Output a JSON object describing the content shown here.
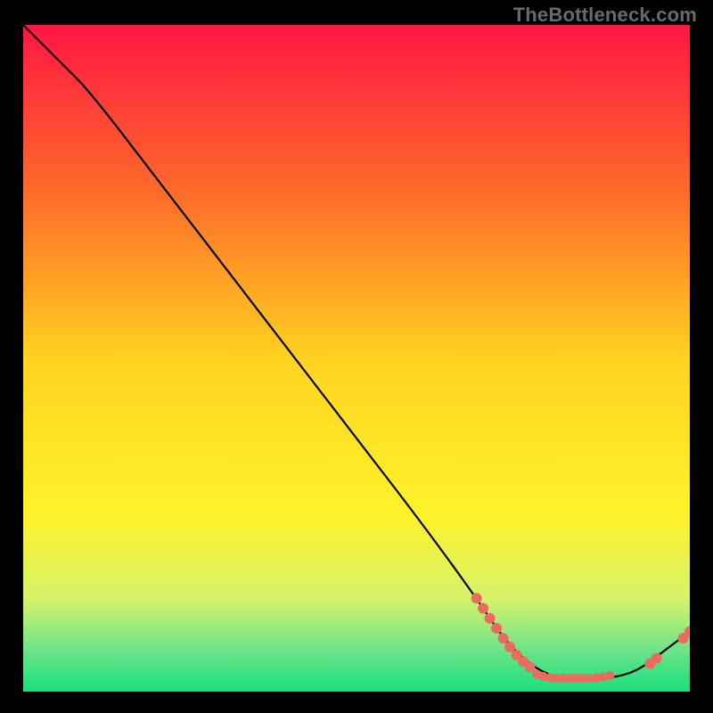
{
  "watermark": "TheBottleneck.com",
  "chart_data": {
    "type": "line",
    "title": "",
    "xlabel": "",
    "ylabel": "",
    "xlim": [
      0,
      100
    ],
    "ylim": [
      0,
      100
    ],
    "grid": false,
    "legend": false,
    "background_gradient": {
      "stops": [
        {
          "offset": 0.0,
          "color": "#ff1744"
        },
        {
          "offset": 0.25,
          "color": "#ff6a2a"
        },
        {
          "offset": 0.5,
          "color": "#ffd321"
        },
        {
          "offset": 0.73,
          "color": "#fff22a"
        },
        {
          "offset": 0.86,
          "color": "#d6f36a"
        },
        {
          "offset": 0.94,
          "color": "#6be38a"
        },
        {
          "offset": 1.0,
          "color": "#17e07a"
        }
      ]
    },
    "curve": {
      "name": "bottleneck-curve",
      "stroke": "#000000",
      "points": [
        {
          "x": 0,
          "y": 100
        },
        {
          "x": 6,
          "y": 94
        },
        {
          "x": 10,
          "y": 90
        },
        {
          "x": 20,
          "y": 77
        },
        {
          "x": 30,
          "y": 64
        },
        {
          "x": 40,
          "y": 51
        },
        {
          "x": 50,
          "y": 38
        },
        {
          "x": 60,
          "y": 25
        },
        {
          "x": 68,
          "y": 14
        },
        {
          "x": 72,
          "y": 8
        },
        {
          "x": 76,
          "y": 4
        },
        {
          "x": 80,
          "y": 2
        },
        {
          "x": 84,
          "y": 2
        },
        {
          "x": 88,
          "y": 2
        },
        {
          "x": 92,
          "y": 3
        },
        {
          "x": 96,
          "y": 6
        },
        {
          "x": 100,
          "y": 9
        }
      ]
    },
    "series": [
      {
        "name": "markers-descent",
        "type": "scatter",
        "color": "#ec6b5e",
        "radius": 6,
        "points": [
          {
            "x": 68,
            "y": 14
          },
          {
            "x": 69,
            "y": 12.5
          },
          {
            "x": 70,
            "y": 11
          },
          {
            "x": 71,
            "y": 9.5
          },
          {
            "x": 72,
            "y": 8
          },
          {
            "x": 73,
            "y": 6.7
          },
          {
            "x": 74,
            "y": 5.5
          },
          {
            "x": 75,
            "y": 4.5
          },
          {
            "x": 76,
            "y": 3.7
          }
        ]
      },
      {
        "name": "markers-valley",
        "type": "scatter",
        "color": "#ec6b5e",
        "radius": 5,
        "points": [
          {
            "x": 77,
            "y": 2.6
          },
          {
            "x": 78,
            "y": 2.3
          },
          {
            "x": 79,
            "y": 2.1
          },
          {
            "x": 80,
            "y": 2.0
          },
          {
            "x": 81,
            "y": 2.0
          },
          {
            "x": 82,
            "y": 2.0
          },
          {
            "x": 83,
            "y": 2.0
          },
          {
            "x": 84,
            "y": 2.0
          },
          {
            "x": 85,
            "y": 2.0
          },
          {
            "x": 86,
            "y": 2.1
          },
          {
            "x": 87,
            "y": 2.2
          },
          {
            "x": 88,
            "y": 2.4
          }
        ]
      },
      {
        "name": "markers-rise",
        "type": "scatter",
        "color": "#ec6b5e",
        "radius": 6,
        "points": [
          {
            "x": 94,
            "y": 4.2
          },
          {
            "x": 95,
            "y": 5.0
          },
          {
            "x": 99,
            "y": 8.0
          },
          {
            "x": 100,
            "y": 9.0
          }
        ]
      }
    ]
  }
}
